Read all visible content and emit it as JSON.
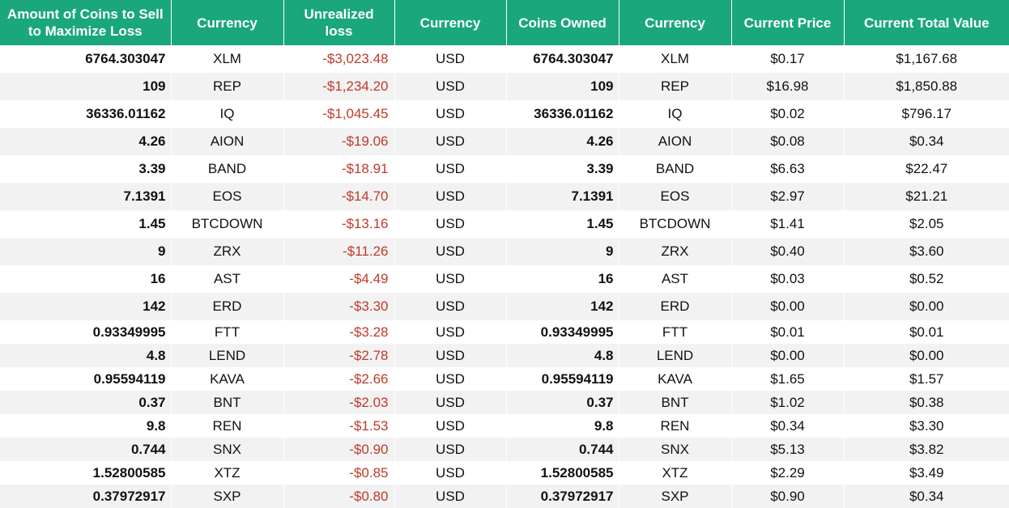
{
  "headers": [
    "Amount of Coins to Sell to Maximize Loss",
    "Currency",
    "Unrealized loss",
    "Currency",
    "Coins Owned",
    "Currency",
    "Current Price",
    "Current Total Value"
  ],
  "rows": [
    [
      "6764.303047",
      "XLM",
      "-$3,023.48",
      "USD",
      "6764.303047",
      "XLM",
      "$0.17",
      "$1,167.68"
    ],
    [
      "109",
      "REP",
      "-$1,234.20",
      "USD",
      "109",
      "REP",
      "$16.98",
      "$1,850.88"
    ],
    [
      "36336.01162",
      "IQ",
      "-$1,045.45",
      "USD",
      "36336.01162",
      "IQ",
      "$0.02",
      "$796.17"
    ],
    [
      "4.26",
      "AION",
      "-$19.06",
      "USD",
      "4.26",
      "AION",
      "$0.08",
      "$0.34"
    ],
    [
      "3.39",
      "BAND",
      "-$18.91",
      "USD",
      "3.39",
      "BAND",
      "$6.63",
      "$22.47"
    ],
    [
      "7.1391",
      "EOS",
      "-$14.70",
      "USD",
      "7.1391",
      "EOS",
      "$2.97",
      "$21.21"
    ],
    [
      "1.45",
      "BTCDOWN",
      "-$13.16",
      "USD",
      "1.45",
      "BTCDOWN",
      "$1.41",
      "$2.05"
    ],
    [
      "9",
      "ZRX",
      "-$11.26",
      "USD",
      "9",
      "ZRX",
      "$0.40",
      "$3.60"
    ],
    [
      "16",
      "AST",
      "-$4.49",
      "USD",
      "16",
      "AST",
      "$0.03",
      "$0.52"
    ],
    [
      "142",
      "ERD",
      "-$3.30",
      "USD",
      "142",
      "ERD",
      "$0.00",
      "$0.00"
    ],
    [
      "0.93349995",
      "FTT",
      "-$3.28",
      "USD",
      "0.93349995",
      "FTT",
      "$0.01",
      "$0.01"
    ],
    [
      "4.8",
      "LEND",
      "-$2.78",
      "USD",
      "4.8",
      "LEND",
      "$0.00",
      "$0.00"
    ],
    [
      "0.95594119",
      "KAVA",
      "-$2.66",
      "USD",
      "0.95594119",
      "KAVA",
      "$1.65",
      "$1.57"
    ],
    [
      "0.37",
      "BNT",
      "-$2.03",
      "USD",
      "0.37",
      "BNT",
      "$1.02",
      "$0.38"
    ],
    [
      "9.8",
      "REN",
      "-$1.53",
      "USD",
      "9.8",
      "REN",
      "$0.34",
      "$3.30"
    ],
    [
      "0.744",
      "SNX",
      "-$0.90",
      "USD",
      "0.744",
      "SNX",
      "$5.13",
      "$3.82"
    ],
    [
      "1.52800585",
      "XTZ",
      "-$0.85",
      "USD",
      "1.52800585",
      "XTZ",
      "$2.29",
      "$3.49"
    ],
    [
      "0.37972917",
      "SXP",
      "-$0.80",
      "USD",
      "0.37972917",
      "SXP",
      "$0.90",
      "$0.34"
    ]
  ],
  "colors": {
    "header_bg": "#1aa77b",
    "header_text": "#ffffff",
    "loss_text": "#c0392b",
    "stripe": "#f2f2f2"
  }
}
